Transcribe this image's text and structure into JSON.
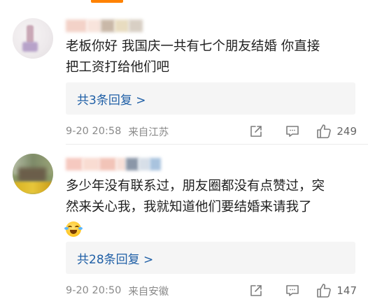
{
  "comments": [
    {
      "text_line1": "老板你好 我国庆一共有七个朋友结婚 你直接",
      "text_line2": "把工资打给他们吧",
      "replies_label": "共3条回复 >",
      "time": "9-20 20:58",
      "location": "来自江苏",
      "likes": "249"
    },
    {
      "text_line1": "多少年没有联系过，朋友圈都没有点赞过，突",
      "text_line2": "然来关心我，我就知道他们要结婚来请我了",
      "emoji": "laugh-cry-emoji",
      "replies_label": "共28条回复 >",
      "time": "9-20 20:50",
      "location": "来自安徽",
      "likes": "147"
    }
  ],
  "colors": {
    "link": "#1f5fa6",
    "meta": "#8a8a8a",
    "reply_bg": "#f5f5f5",
    "accent": "#ff8200"
  },
  "icons": {
    "share": "share-icon",
    "comment": "comment-icon",
    "like": "thumbs-up-icon"
  }
}
